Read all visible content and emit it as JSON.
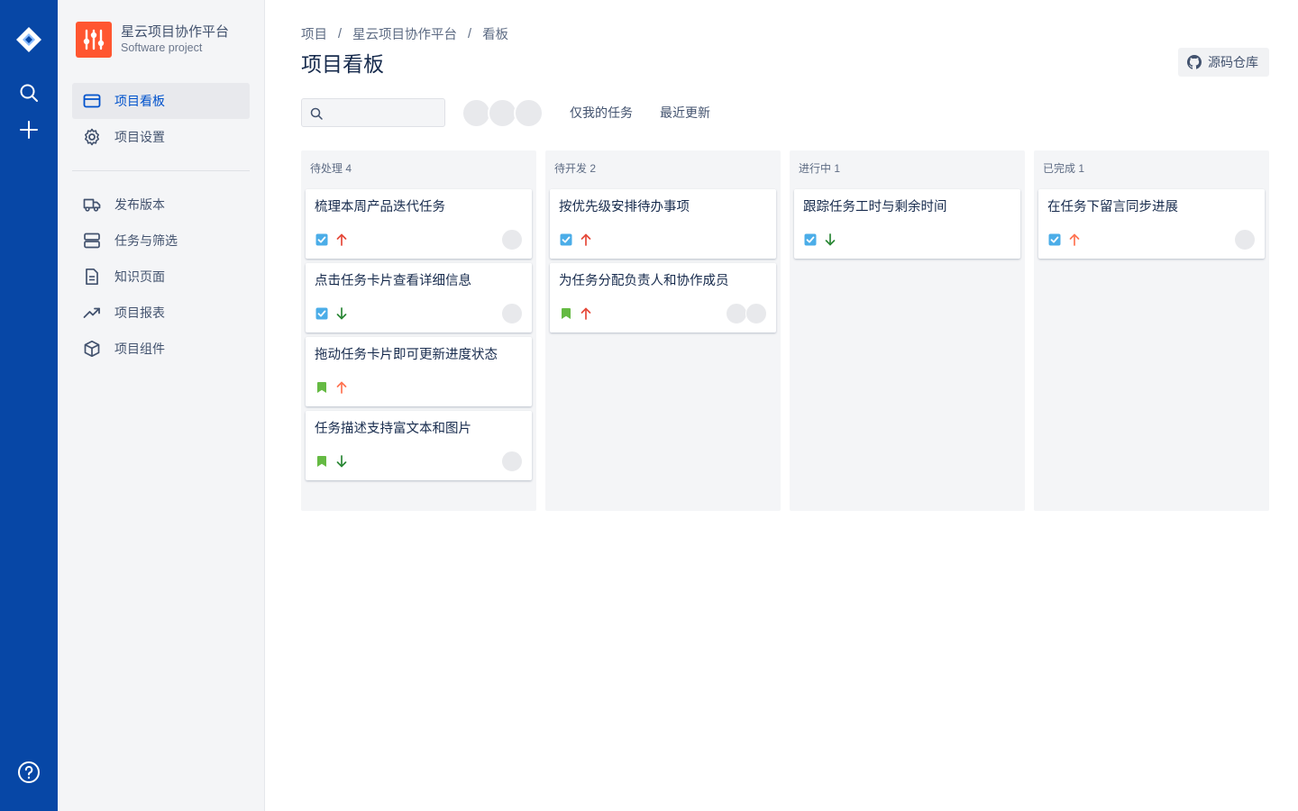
{
  "rail": {
    "logo": "jira-diamond-icon",
    "items": [
      "search-icon",
      "plus-icon"
    ],
    "help": "help-icon"
  },
  "project": {
    "name": "星云项目协作平台",
    "type": "Software project",
    "avatar_color": "#ff5630"
  },
  "nav": {
    "primary": [
      {
        "label": "项目看板",
        "icon": "board-icon",
        "active": true
      },
      {
        "label": "项目设置",
        "icon": "gear-icon",
        "active": false
      }
    ],
    "secondary": [
      {
        "label": "发布版本",
        "icon": "truck-icon"
      },
      {
        "label": "任务与筛选",
        "icon": "stack-icon"
      },
      {
        "label": "知识页面",
        "icon": "page-icon"
      },
      {
        "label": "项目报表",
        "icon": "trend-icon"
      },
      {
        "label": "项目组件",
        "icon": "box-icon"
      }
    ]
  },
  "breadcrumb": [
    "项目",
    "星云项目协作平台",
    "看板"
  ],
  "breadcrumb_sep": "/",
  "page_title": "项目看板",
  "repo_button": "源码仓库",
  "filters": {
    "search_placeholder": "",
    "only_mine": "仅我的任务",
    "recent": "最近更新"
  },
  "colors": {
    "rail": "#0747a6",
    "accent": "#0052cc",
    "task_blue": "#4bade8",
    "story_green": "#65ba43",
    "prio_high_red": "#e5493a",
    "prio_medium_orange": "#ff7452",
    "prio_low_green": "#2a8735"
  },
  "columns": [
    {
      "title": "待处理 4",
      "cards": [
        {
          "title": "梳理本周产品迭代任务",
          "type": "task",
          "priority": "high",
          "assignees": 1
        },
        {
          "title": "点击任务卡片查看详细信息",
          "type": "task",
          "priority": "low",
          "assignees": 1
        },
        {
          "title": "拖动任务卡片即可更新进度状态",
          "type": "story",
          "priority": "medium",
          "assignees": 0
        },
        {
          "title": "任务描述支持富文本和图片",
          "type": "story",
          "priority": "low",
          "assignees": 1
        }
      ]
    },
    {
      "title": "待开发 2",
      "cards": [
        {
          "title": "按优先级安排待办事项",
          "type": "task",
          "priority": "high",
          "assignees": 0
        },
        {
          "title": "为任务分配负责人和协作成员",
          "type": "story",
          "priority": "high",
          "assignees": 2
        }
      ]
    },
    {
      "title": "进行中 1",
      "cards": [
        {
          "title": "跟踪任务工时与剩余时间",
          "type": "task",
          "priority": "low",
          "assignees": 0
        }
      ]
    },
    {
      "title": "已完成 1",
      "cards": [
        {
          "title": "在任务下留言同步进展",
          "type": "task",
          "priority": "medium",
          "assignees": 1
        }
      ]
    }
  ]
}
